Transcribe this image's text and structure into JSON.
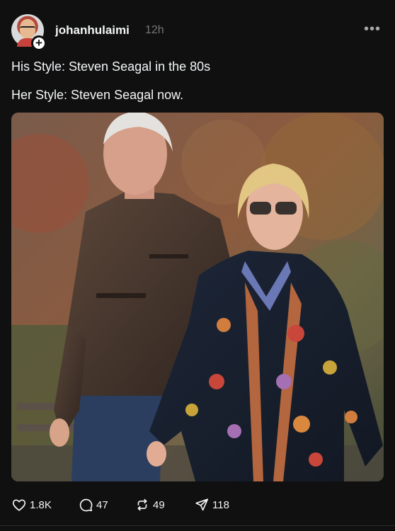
{
  "post": {
    "username": "johanhulaimi",
    "timestamp": "12h",
    "more_label": "•••",
    "follow_badge": "+",
    "text_lines": [
      "His Style: Steven Seagal in the 80s",
      "Her Style: Steven Seagal now."
    ],
    "image_icon": "photo-of-two-people-walking"
  },
  "actions": {
    "likes": "1.8K",
    "replies": "47",
    "reposts": "49",
    "shares": "118"
  },
  "colors": {
    "background": "#101010",
    "text": "#f3f5f7",
    "muted": "#777777"
  }
}
